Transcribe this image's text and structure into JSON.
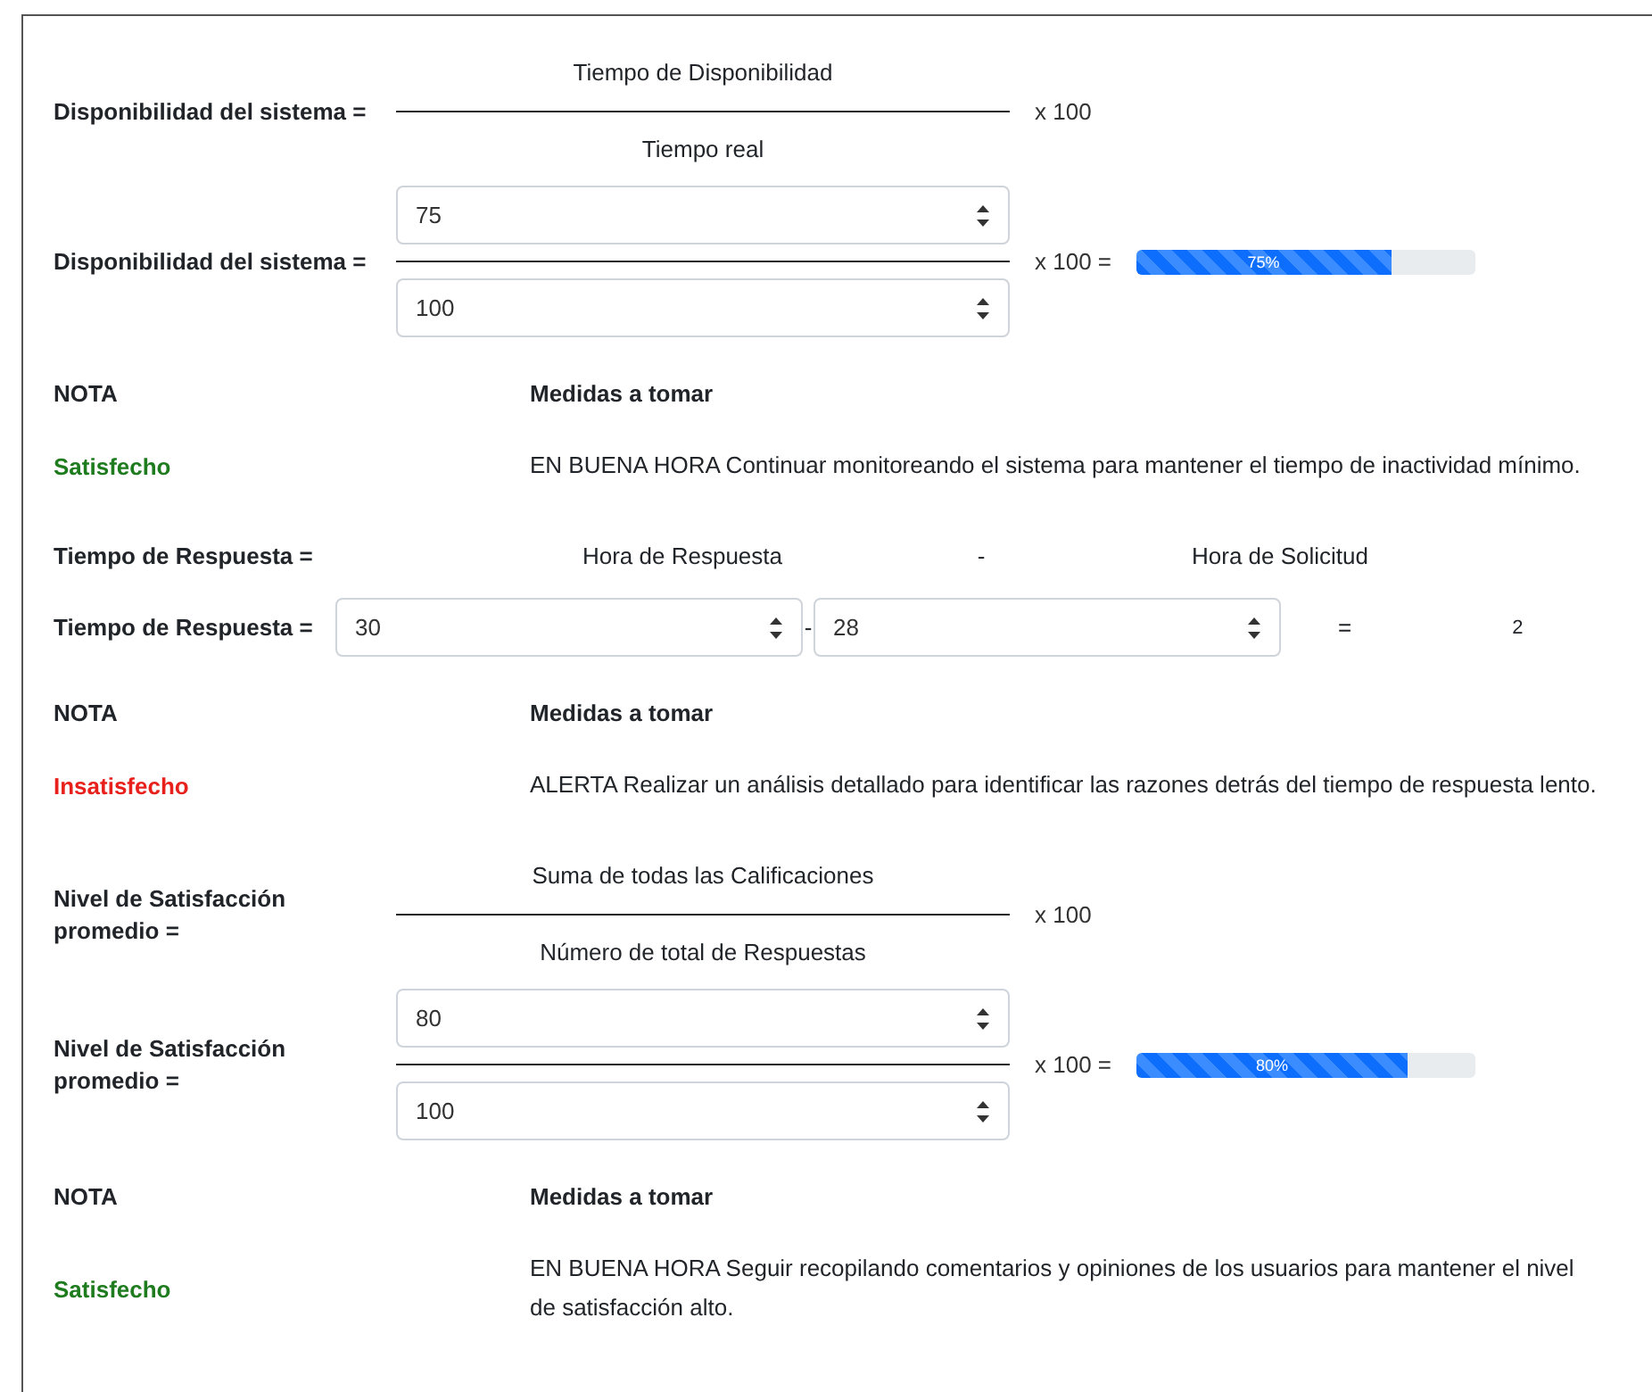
{
  "sections": [
    {
      "kind": "fraction",
      "formula": {
        "label": "Disponibilidad del sistema =",
        "numerator": "Tiempo de Disponibilidad",
        "denominator": "Tiempo real",
        "multiplier": "x 100"
      },
      "calc": {
        "label": "Disponibilidad del sistema =",
        "numerator_value": "75",
        "denominator_value": "100",
        "multiplier": "x 100 =",
        "progress": {
          "level": 0.75,
          "label": "75%"
        }
      },
      "note": {
        "note_heading": "NOTA",
        "action_heading": "Medidas a tomar",
        "status": "Satisfecho",
        "color": "#1e7b1e",
        "action": "EN BUENA HORA Continuar monitoreando el sistema para mantener el tiempo de inactividad mínimo."
      }
    },
    {
      "kind": "difference",
      "formula": {
        "label": "Tiempo de Respuesta =",
        "minuend": "Hora de Respuesta",
        "operator": "-",
        "subtrahend": "Hora de Solicitud"
      },
      "calc": {
        "label": "Tiempo de Respuesta =",
        "minuend_value": "30",
        "operator": "-",
        "subtrahend_value": "28",
        "equals": "=",
        "result": "2"
      },
      "note": {
        "note_heading": "NOTA",
        "action_heading": "Medidas a tomar",
        "status": "Insatisfecho",
        "color": "#e8201c",
        "action": "ALERTA Realizar un análisis detallado para identificar las razones detrás del tiempo de respuesta lento."
      }
    },
    {
      "kind": "fraction",
      "formula": {
        "label": "Nivel de Satisfacción promedio =",
        "numerator": "Suma de todas las Calificaciones",
        "denominator": "Número de total de Respuestas",
        "multiplier": "x 100"
      },
      "calc": {
        "label": "Nivel de Satisfacción promedio =",
        "numerator_value": "80",
        "denominator_value": "100",
        "multiplier": "x 100 =",
        "progress": {
          "level": 0.8,
          "label": "80%"
        }
      },
      "note": {
        "note_heading": "NOTA",
        "action_heading": "Medidas a tomar",
        "status": "Satisfecho",
        "color": "#1e7b1e",
        "action": "EN BUENA HORA Seguir recopilando comentarios y opiniones de los usuarios para mantener el nivel de satisfacción alto."
      }
    }
  ]
}
